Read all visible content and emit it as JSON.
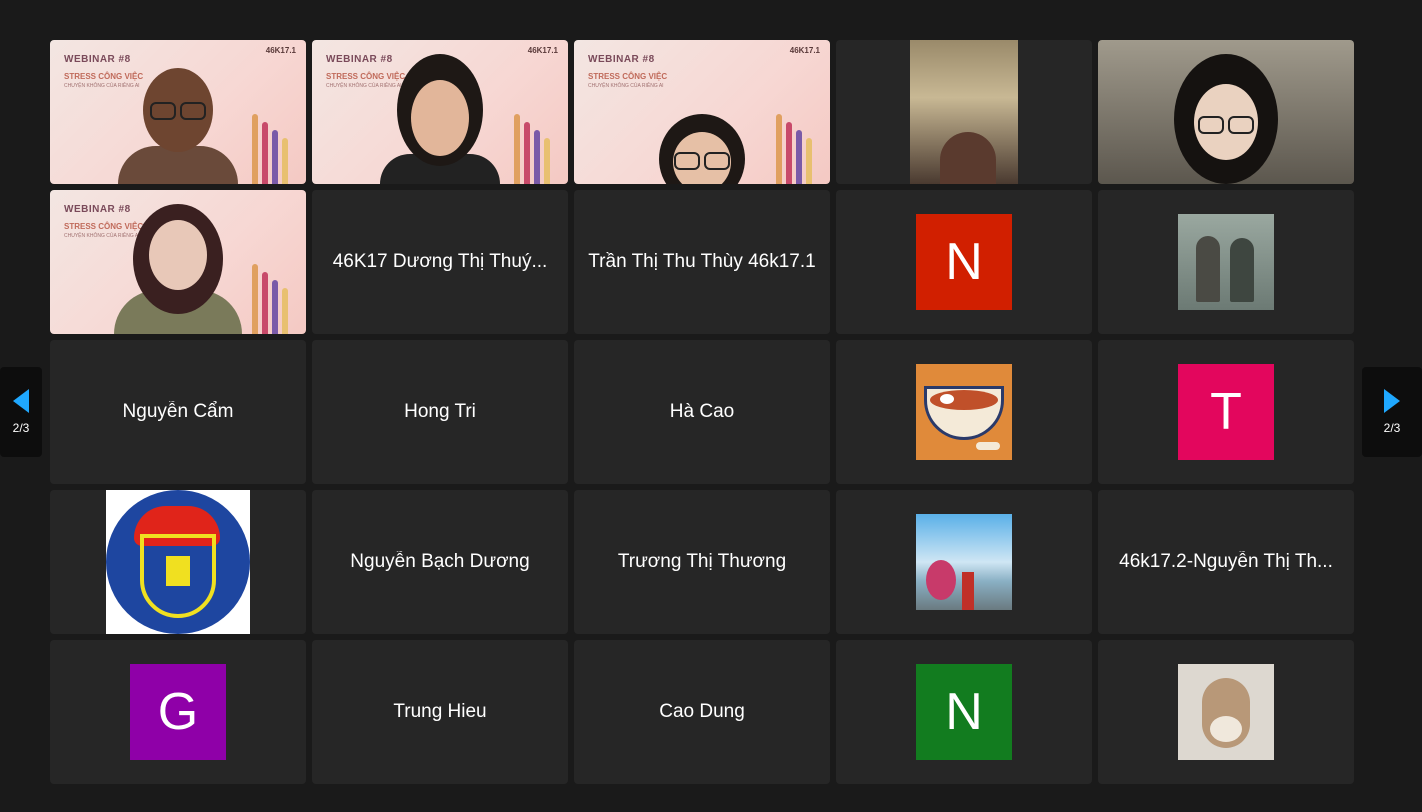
{
  "pagination": {
    "label": "2/3"
  },
  "video_tiles": {
    "webinar_title": "WEBINAR #8",
    "webinar_subtitle": "STRESS CÔNG VIỆC",
    "webinar_tagline": "CHUYỆN KHÔNG CỦA RIÊNG AI",
    "brand": "46K17.1"
  },
  "participants": [
    {
      "name": "46K17 Dương Thị Thuý..."
    },
    {
      "name": "Trần Thị Thu Thùy 46k17.1"
    },
    {
      "initial": "N",
      "color": "#d11f00"
    },
    {
      "picture": "kids-photo"
    },
    {
      "name": "Nguyễn Cẩm"
    },
    {
      "name": "Hong Tri"
    },
    {
      "name": "Hà Cao"
    },
    {
      "picture": "noodle-bowl-illustration"
    },
    {
      "initial": "T",
      "color": "#e3065d"
    },
    {
      "picture": "university-emblem"
    },
    {
      "name": "Nguyễn Bạch Dương"
    },
    {
      "name": "Trương Thị Thương"
    },
    {
      "picture": "seaside-photo"
    },
    {
      "name": "46k17.2-Nguyễn Thị Th..."
    },
    {
      "initial": "G",
      "color": "#8f00a8"
    },
    {
      "name": "Trung Hieu"
    },
    {
      "name": "Cao Dung"
    },
    {
      "initial": "N",
      "color": "#127c1f"
    },
    {
      "picture": "cat-photo"
    }
  ]
}
